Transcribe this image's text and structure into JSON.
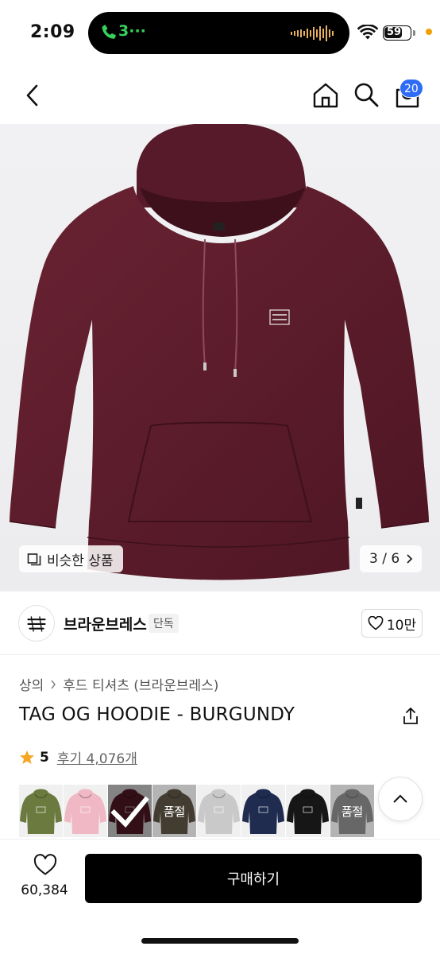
{
  "status_bar": {
    "time": "2:09",
    "call_text": "3···",
    "battery": "59",
    "call_color": "#35d15b"
  },
  "header": {
    "cart_count": "20",
    "icons": [
      "back-icon",
      "home-icon",
      "search-icon",
      "cart-icon"
    ],
    "badge_color": "#2f6cf6"
  },
  "hero": {
    "similar_label": "비슷한 상품",
    "page_indicator": "3 / 6",
    "product_color": "#5c1a2a"
  },
  "brand": {
    "name": "브라운브레스",
    "tag": "단독",
    "likes": "10만"
  },
  "product": {
    "breadcrumb": [
      "상의",
      "후드 티셔츠 (브라운브레스)"
    ],
    "title": "TAG OG HOODIE - BURGUNDY",
    "rating": "5",
    "reviews": "후기 4,076개"
  },
  "swatches": [
    {
      "color": "#6b7a3e",
      "overlay": ""
    },
    {
      "color": "#f0b7c4",
      "overlay": ""
    },
    {
      "color": "#5c1a2a",
      "overlay": "",
      "selected": true
    },
    {
      "color": "#5a5142",
      "overlay": "품절"
    },
    {
      "color": "#c9c9c9",
      "overlay": ""
    },
    {
      "color": "#1f2b4f",
      "overlay": ""
    },
    {
      "color": "#161616",
      "overlay": ""
    },
    {
      "color": "#8a8a8a",
      "overlay": "품절"
    }
  ],
  "bottom": {
    "wish_count": "60,384",
    "buy_label": "구매하기"
  }
}
